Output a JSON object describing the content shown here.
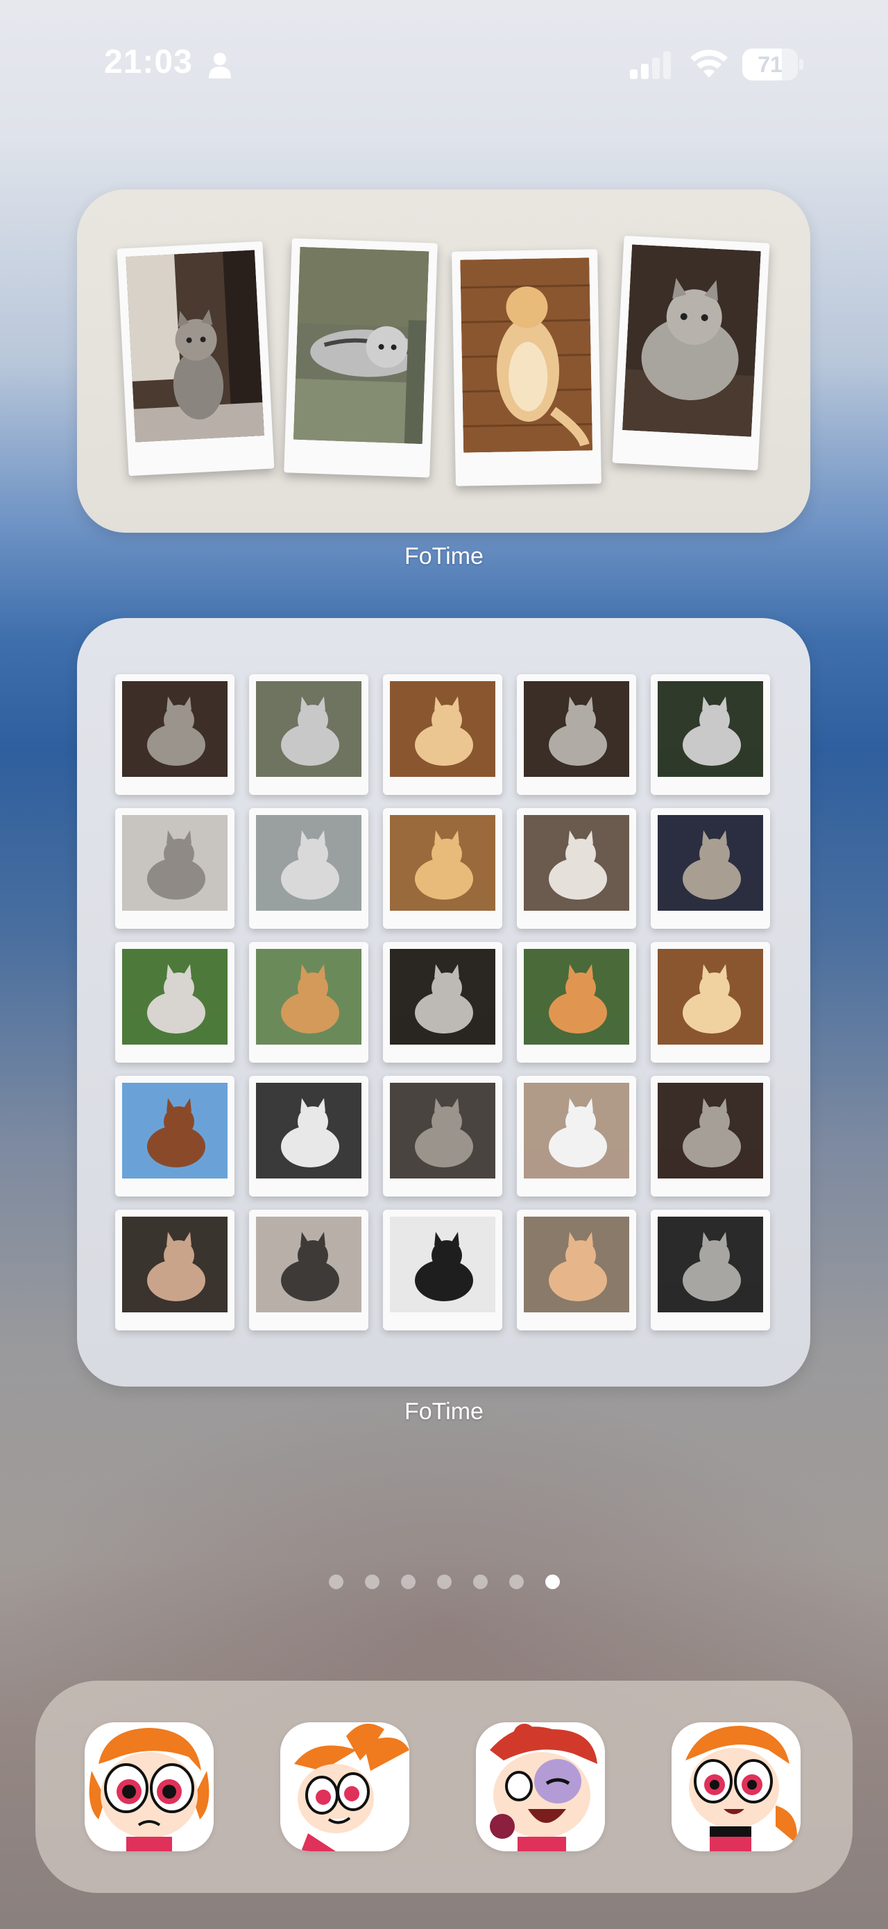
{
  "status_bar": {
    "time": "21:03",
    "battery_level": "71",
    "icons": [
      "person-icon",
      "cellular-signal-icon",
      "wifi-icon",
      "battery-icon"
    ]
  },
  "widgets": [
    {
      "label": "FoTime",
      "type": "polaroid-stack",
      "photo_count": 4
    },
    {
      "label": "FoTime",
      "type": "polaroid-grid",
      "rows": 5,
      "columns": 5,
      "photo_count": 25
    }
  ],
  "page_indicator": {
    "pages": 7,
    "current": 7
  },
  "dock": {
    "apps": [
      {
        "name": "powerpuff-blossom-app-1",
        "icon": "blossom-sad-icon"
      },
      {
        "name": "powerpuff-blossom-app-2",
        "icon": "blossom-angry-icon"
      },
      {
        "name": "powerpuff-blossom-app-3",
        "icon": "blossom-bruised-icon"
      },
      {
        "name": "powerpuff-blossom-app-4",
        "icon": "blossom-happy-icon"
      }
    ]
  },
  "colors": {
    "wallpaper_blue": "#2f5f9e",
    "widget_small_bg": "#e6e2dc",
    "widget_large_bg": "#dcdfe5",
    "dot_active": "#ffffff"
  }
}
